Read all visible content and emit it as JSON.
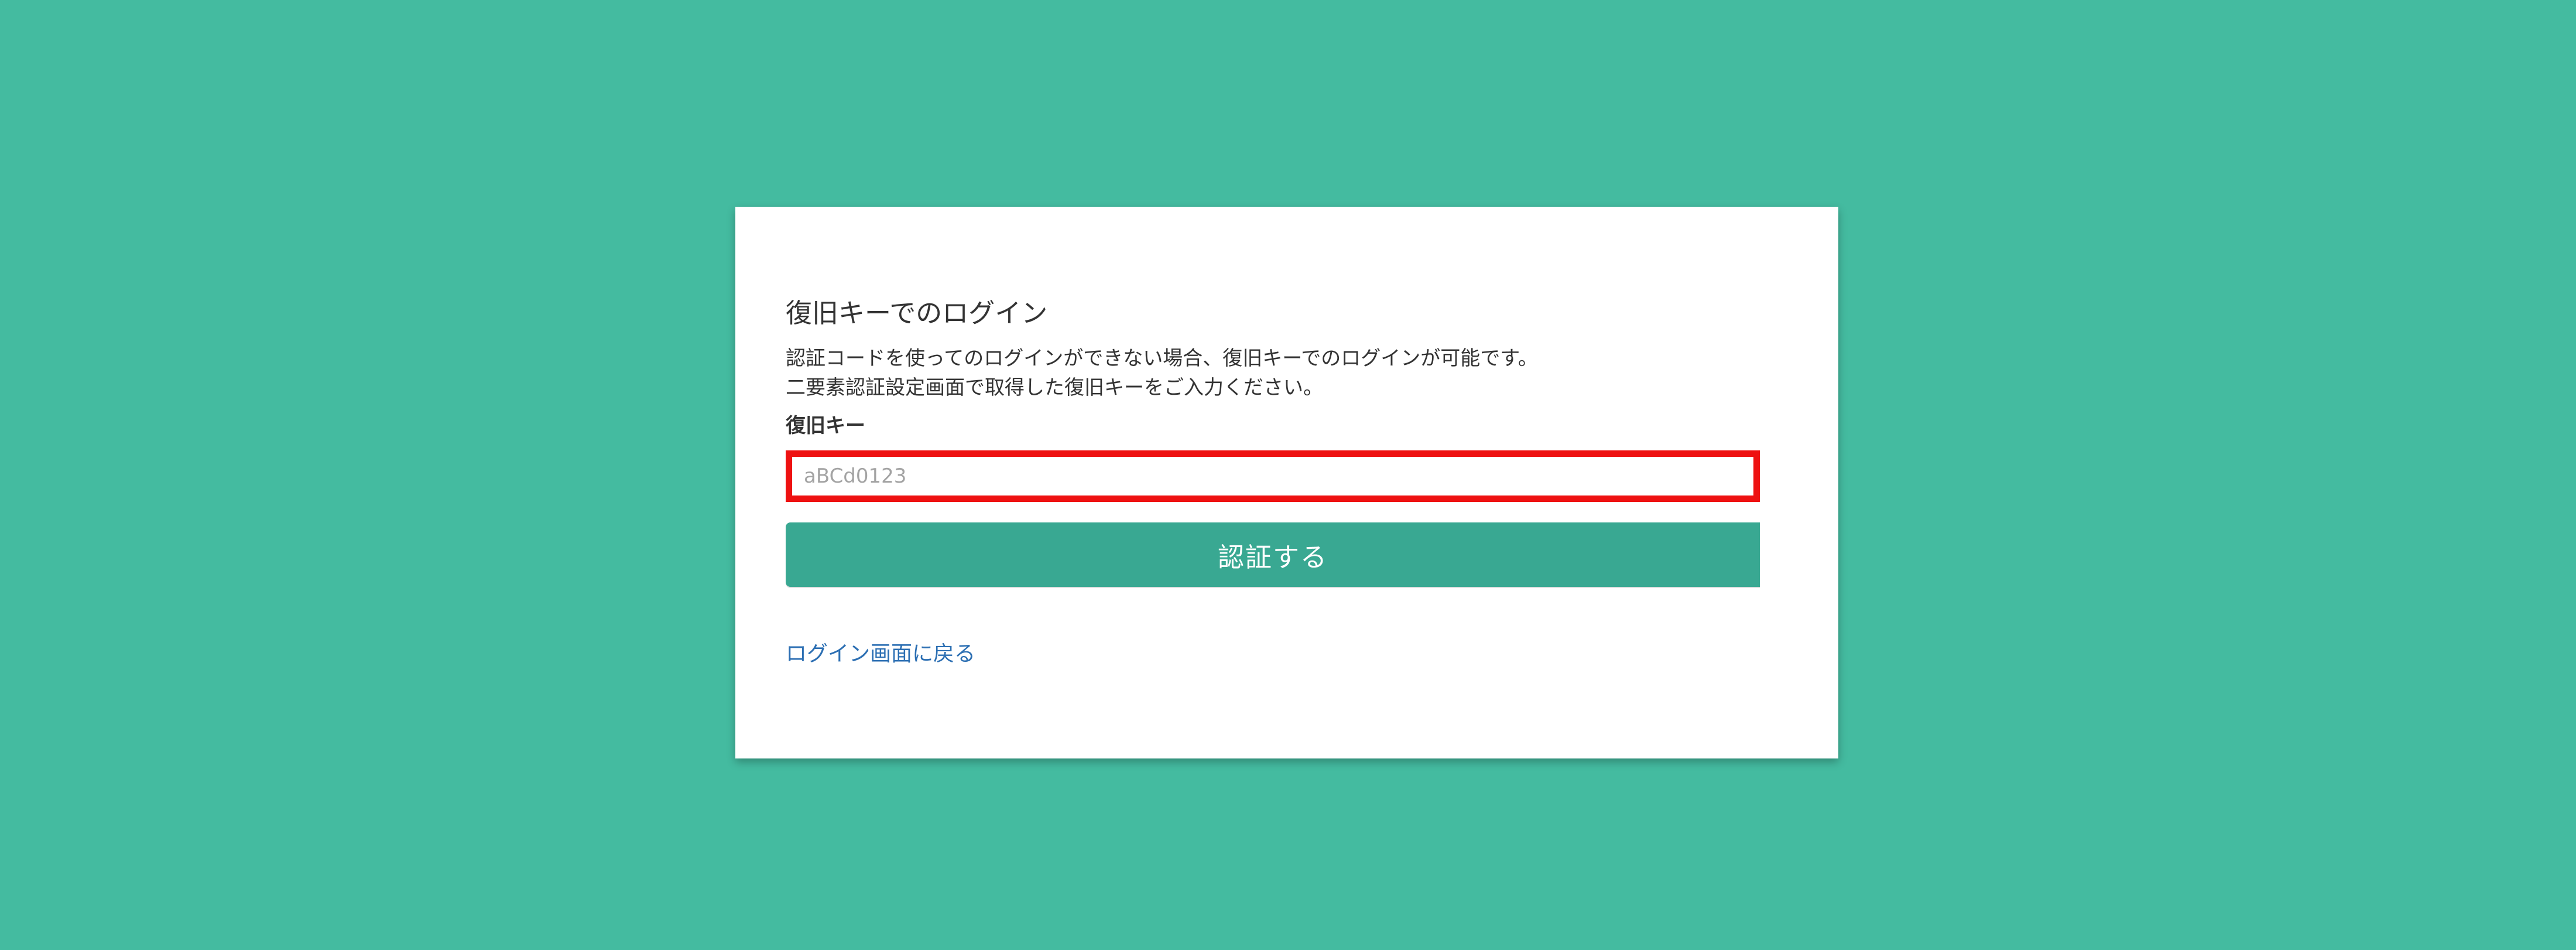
{
  "page": {
    "background_color": "#44bba0"
  },
  "card": {
    "title": "復旧キーでのログイン",
    "description_line1": "認証コードを使ってのログインができない場合、復旧キーでのログインが可能です。",
    "description_line2": "二要素認証設定画面で取得した復旧キーをご入力ください。",
    "field_label": "復旧キー",
    "input": {
      "value": "",
      "placeholder": "aBCd0123"
    },
    "submit_label": "認証する",
    "back_link_label": "ログイン画面に戻る"
  },
  "colors": {
    "accent": "#39a892",
    "highlight_border": "#ee1111",
    "link": "#2c6fb3"
  }
}
